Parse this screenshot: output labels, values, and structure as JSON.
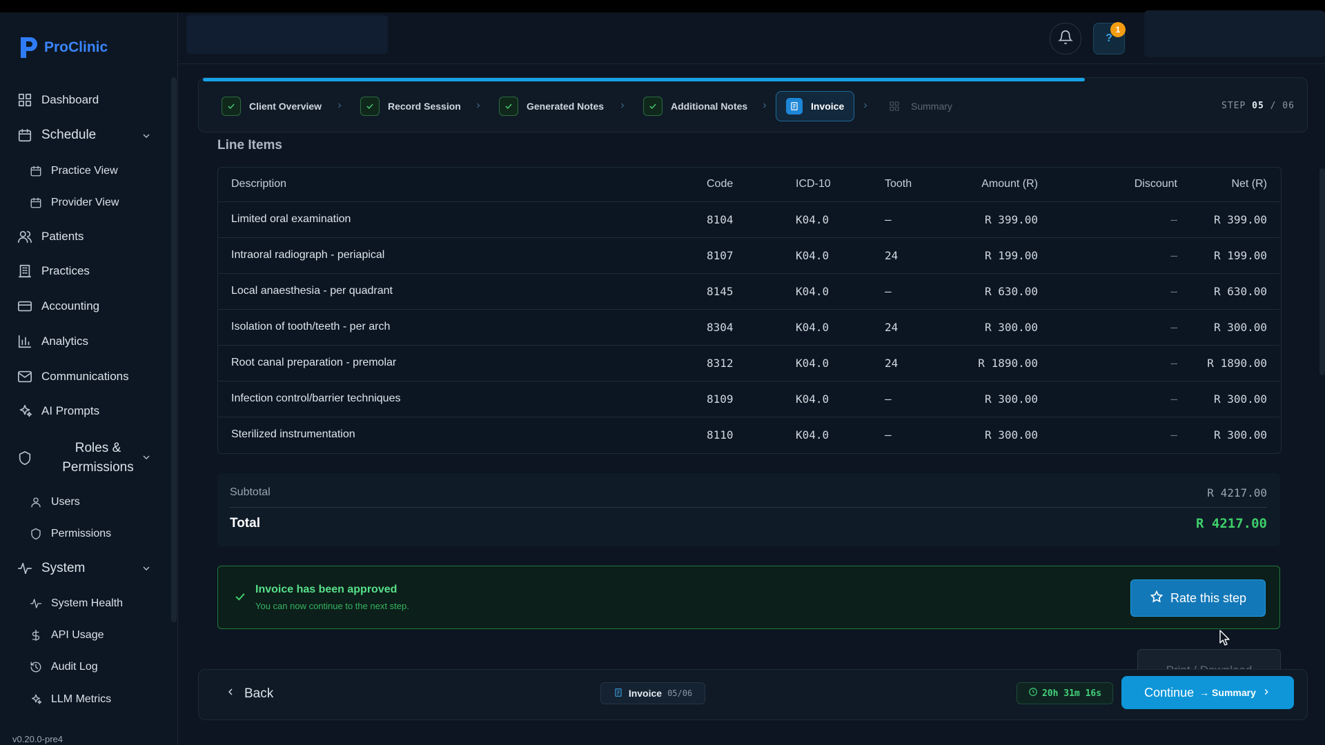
{
  "brand": {
    "name": "ProClinic"
  },
  "sidebar": {
    "items": [
      {
        "label": "Dashboard",
        "icon": "grid-icon"
      },
      {
        "label": "Schedule",
        "icon": "calendar-icon"
      },
      {
        "label": "Practice View",
        "icon": "calendar-icon"
      },
      {
        "label": "Provider View",
        "icon": "calendar-icon"
      },
      {
        "label": "Patients",
        "icon": "users-icon"
      },
      {
        "label": "Practices",
        "icon": "building-icon"
      },
      {
        "label": "Accounting",
        "icon": "credit-card-icon"
      },
      {
        "label": "Analytics",
        "icon": "bar-chart-icon"
      },
      {
        "label": "Communications",
        "icon": "mail-icon"
      },
      {
        "label": "AI Prompts",
        "icon": "sparkles-icon"
      },
      {
        "label": "Roles & Permissions",
        "icon": "shield-icon"
      },
      {
        "label": "Users",
        "icon": "user-icon"
      },
      {
        "label": "Permissions",
        "icon": "shield-icon"
      },
      {
        "label": "System",
        "icon": "activity-icon"
      },
      {
        "label": "System Health",
        "icon": "activity-icon"
      },
      {
        "label": "API Usage",
        "icon": "dollar-icon"
      },
      {
        "label": "Audit Log",
        "icon": "history-icon"
      },
      {
        "label": "LLM Metrics",
        "icon": "sparkles-icon"
      }
    ],
    "version": "v0.20.0-pre4"
  },
  "header": {
    "help_badge": "1"
  },
  "stepper": {
    "steps": [
      {
        "label": "Client Overview",
        "state": "done"
      },
      {
        "label": "Record Session",
        "state": "done"
      },
      {
        "label": "Generated Notes",
        "state": "done"
      },
      {
        "label": "Additional Notes",
        "state": "done"
      },
      {
        "label": "Invoice",
        "state": "active"
      },
      {
        "label": "Summary",
        "state": "upcoming"
      }
    ],
    "step_label": "STEP",
    "current": "05",
    "sep": "/",
    "total": "06",
    "progress": 0.8
  },
  "line_items": {
    "title": "Line Items",
    "columns": [
      "Description",
      "Code",
      "ICD-10",
      "Tooth",
      "Amount (R)",
      "Discount",
      "Net (R)"
    ],
    "rows": [
      {
        "description": "Limited oral examination",
        "code": "8104",
        "icd": "K04.0",
        "tooth": "—",
        "amount": "R 399.00",
        "discount": "–",
        "net": "R 399.00"
      },
      {
        "description": "Intraoral radiograph - periapical",
        "code": "8107",
        "icd": "K04.0",
        "tooth": "24",
        "amount": "R 199.00",
        "discount": "–",
        "net": "R 199.00"
      },
      {
        "description": "Local anaesthesia - per quadrant",
        "code": "8145",
        "icd": "K04.0",
        "tooth": "—",
        "amount": "R 630.00",
        "discount": "–",
        "net": "R 630.00"
      },
      {
        "description": "Isolation of tooth/teeth - per arch",
        "code": "8304",
        "icd": "K04.0",
        "tooth": "24",
        "amount": "R 300.00",
        "discount": "–",
        "net": "R 300.00"
      },
      {
        "description": "Root canal preparation - premolar",
        "code": "8312",
        "icd": "K04.0",
        "tooth": "24",
        "amount": "R 1890.00",
        "discount": "–",
        "net": "R 1890.00"
      },
      {
        "description": "Infection control/barrier techniques",
        "code": "8109",
        "icd": "K04.0",
        "tooth": "—",
        "amount": "R 300.00",
        "discount": "–",
        "net": "R 300.00"
      },
      {
        "description": "Sterilized instrumentation",
        "code": "8110",
        "icd": "K04.0",
        "tooth": "—",
        "amount": "R 300.00",
        "discount": "–",
        "net": "R 300.00"
      }
    ]
  },
  "totals": {
    "subtotal_label": "Subtotal",
    "subtotal_value": "R 4217.00",
    "total_label": "Total",
    "total_value": "R 4217.00"
  },
  "approval": {
    "title": "Invoice has been approved",
    "subtitle": "You can now continue to the next step.",
    "rate_label": "Rate this step",
    "print_label": "Print / Download"
  },
  "footer": {
    "back_label": "Back",
    "current_step": "Invoice",
    "step_pos": "05/06",
    "timer": "20h 31m 16s",
    "continue_label": "Continue",
    "next_label": "→ Summary"
  },
  "colors": {
    "accent": "#0e96d9",
    "success": "#3ecf6a",
    "badge": "#f39c12",
    "brand": "#3a86ff"
  }
}
